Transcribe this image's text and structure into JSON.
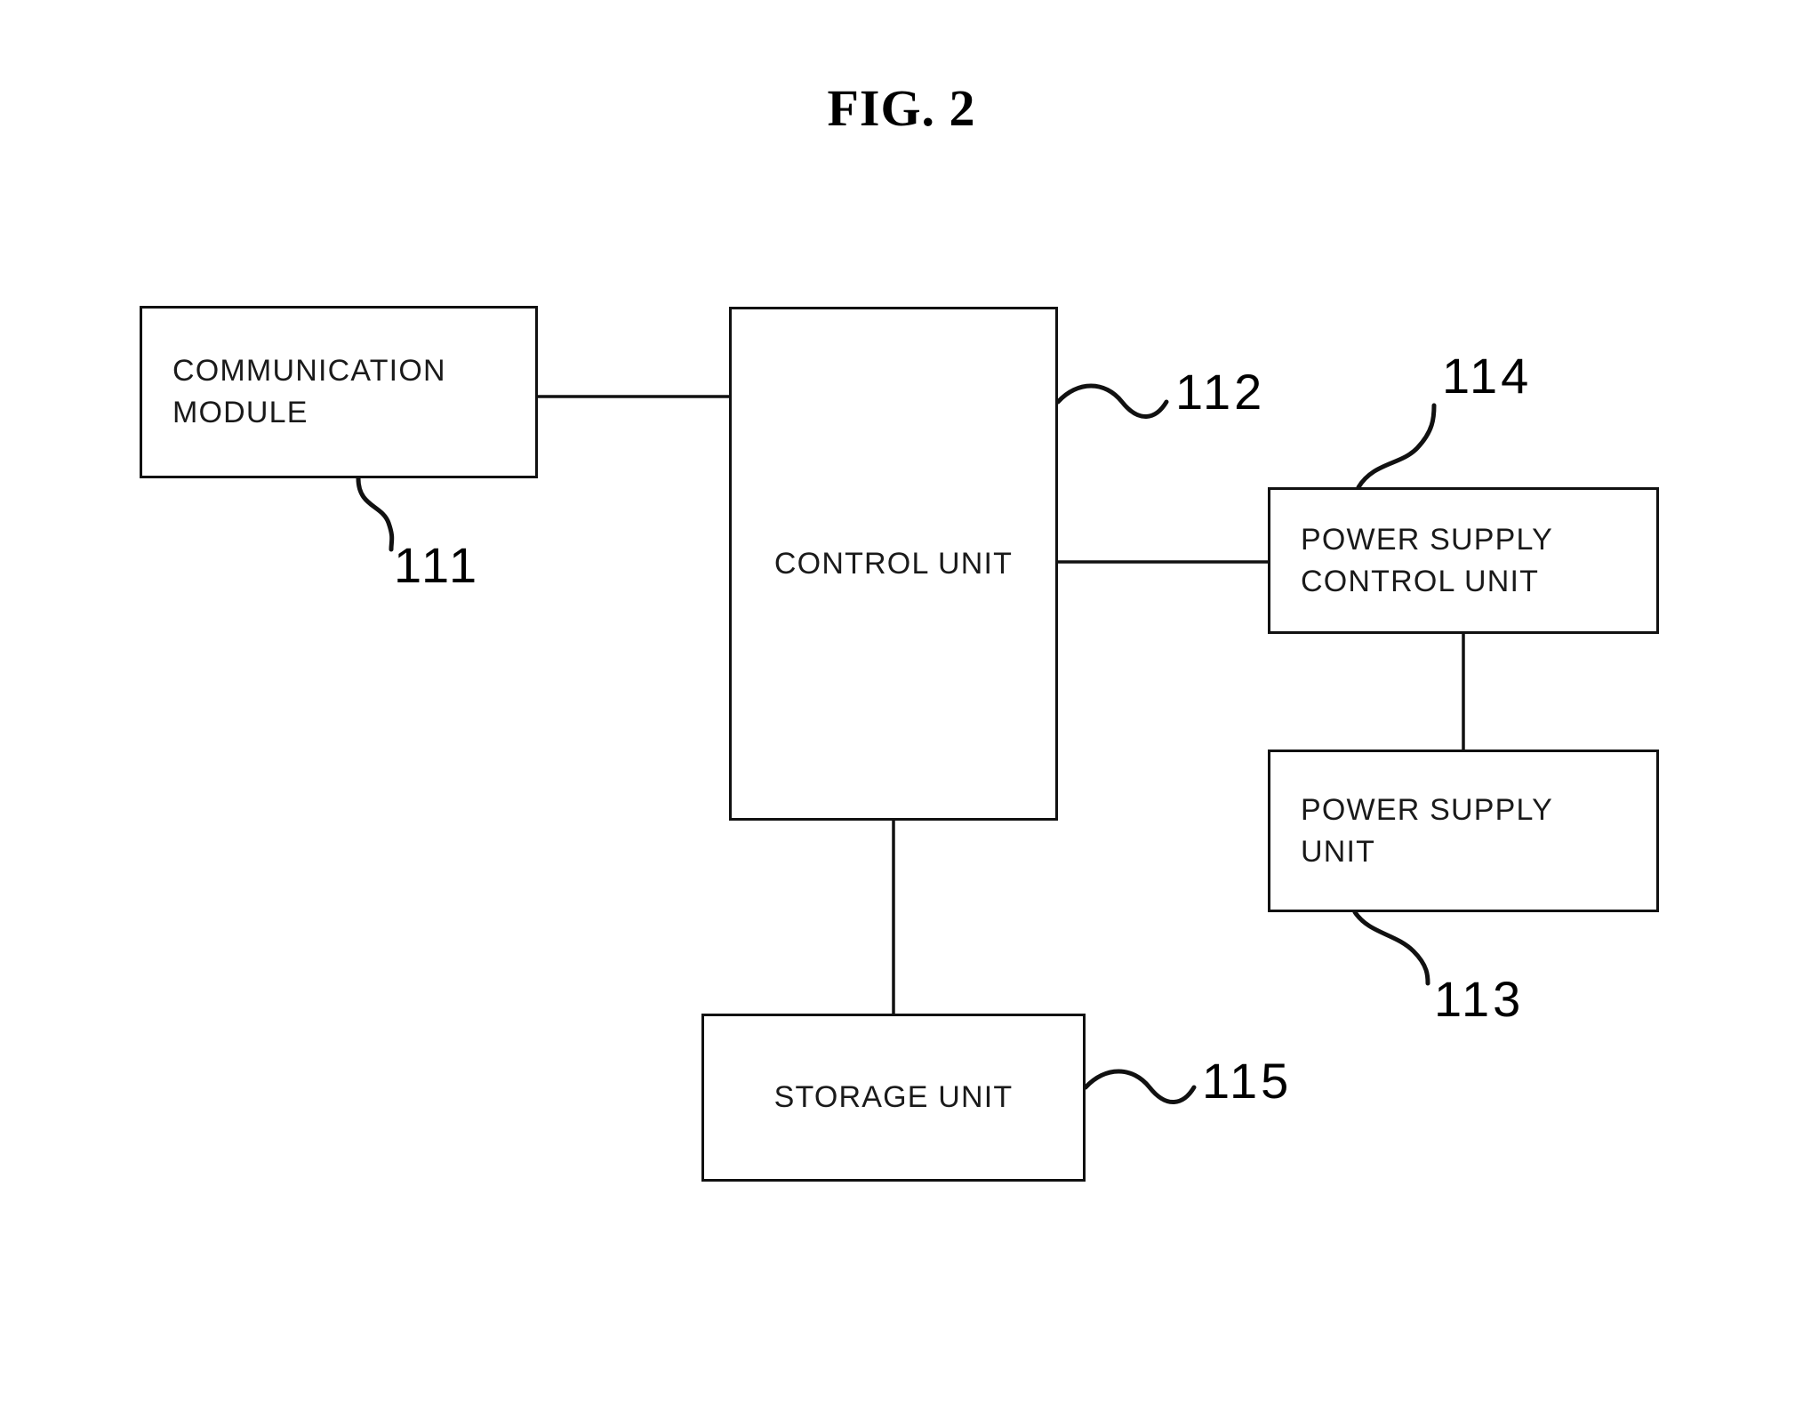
{
  "figure": {
    "title": "FIG. 2",
    "type": "patent-block-diagram"
  },
  "blocks": [
    {
      "id": "communication-module",
      "label": "COMMUNICATION\nMODULE",
      "ref": "111"
    },
    {
      "id": "control-unit",
      "label": "CONTROL UNIT",
      "ref": "112"
    },
    {
      "id": "power-supply-control-unit",
      "label": "POWER SUPPLY\nCONTROL UNIT",
      "ref": "114"
    },
    {
      "id": "power-supply-unit",
      "label": "POWER SUPPLY\nUNIT",
      "ref": "113"
    },
    {
      "id": "storage-unit",
      "label": "STORAGE UNIT",
      "ref": "115"
    }
  ],
  "reference_numerals": {
    "communication_module": "111",
    "control_unit": "112",
    "power_supply_unit": "113",
    "power_supply_control_unit": "114",
    "storage_unit": "115"
  },
  "connections": [
    {
      "from": "communication-module",
      "to": "control-unit"
    },
    {
      "from": "control-unit",
      "to": "power-supply-control-unit"
    },
    {
      "from": "power-supply-control-unit",
      "to": "power-supply-unit"
    },
    {
      "from": "control-unit",
      "to": "storage-unit"
    }
  ],
  "colors": {
    "stroke": "#111111",
    "text": "#1a1a1a",
    "background": "#ffffff"
  }
}
